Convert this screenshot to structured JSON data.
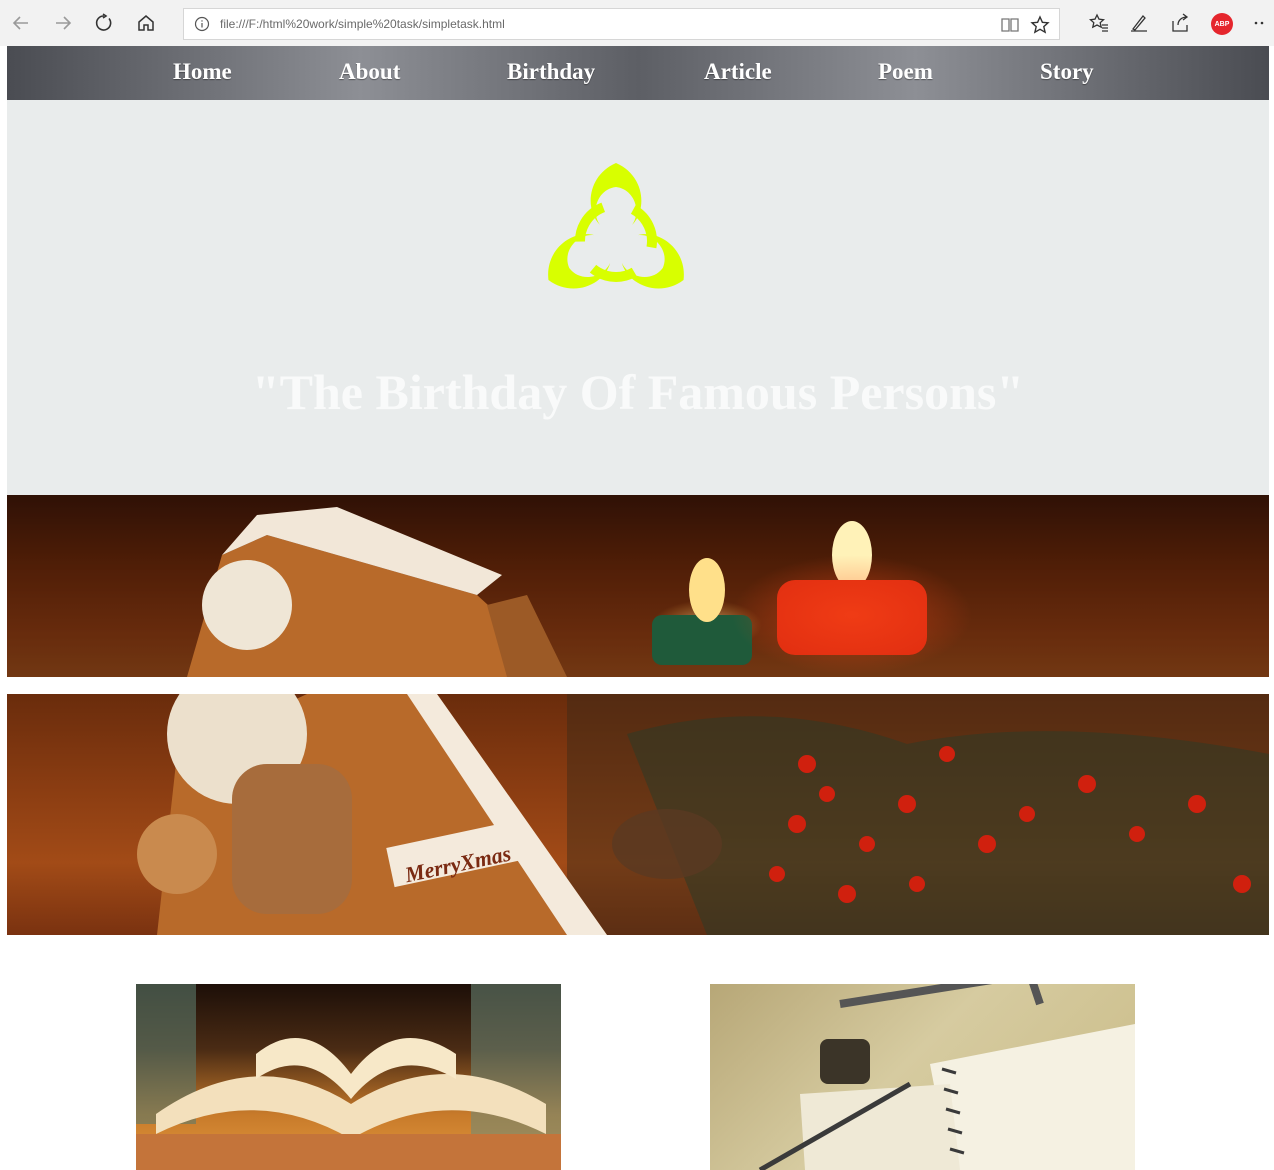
{
  "browser": {
    "url": "file:///F:/html%20work/simple%20task/simpletask.html",
    "adblock_badge": "ABP",
    "icons": [
      "back-arrow-icon",
      "forward-arrow-icon",
      "refresh-icon",
      "home-icon",
      "info-icon",
      "reading-view-icon",
      "favorite-star-icon",
      "favorites-list-icon",
      "pen-icon",
      "share-icon",
      "more-icon"
    ]
  },
  "nav": {
    "items": [
      "Home",
      "About",
      "Birthday",
      "Article",
      "Poem",
      "Story"
    ]
  },
  "hero": {
    "logo_icon": "biohazard-icon",
    "logo_color": "#d8ff00",
    "title": "\"The Birthday Of Famous Persons\""
  },
  "banners": [
    {
      "description_icon": "gingerbread-house-candles-image"
    },
    {
      "description_icon": "gingerbread-house-berries-image",
      "sign_text": "MerryXmas"
    }
  ],
  "cards": [
    {
      "image_icon": "open-books-image"
    },
    {
      "image_icon": "notebook-pen-ink-image"
    }
  ],
  "colors": {
    "navbar": "#6f7177",
    "hero_background": "#e9ecec",
    "hero_title": "#f9fafa"
  }
}
